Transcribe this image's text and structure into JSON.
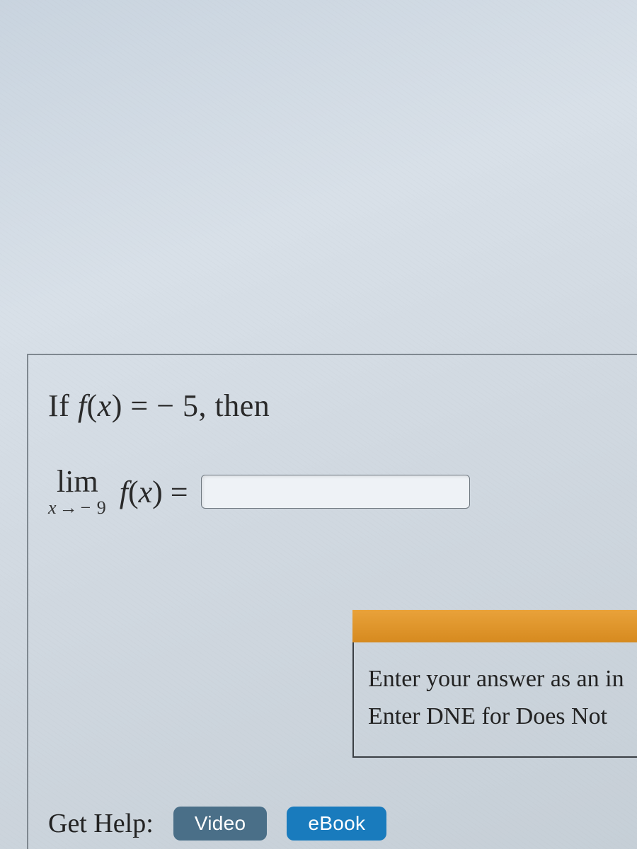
{
  "problem": {
    "prompt_prefix": "If ",
    "func_name": "f",
    "var_name": "x",
    "equals": " = ",
    "value": "− 5",
    "then": ", then",
    "lim_label": "lim",
    "lim_var": "x",
    "lim_arrow": "→",
    "lim_target": "− 9",
    "answer_value": ""
  },
  "hint": {
    "line1": "Enter your answer as an in",
    "line2": "Enter DNE for Does Not "
  },
  "help": {
    "label": "Get Help:",
    "video": "Video",
    "ebook": "eBook"
  }
}
